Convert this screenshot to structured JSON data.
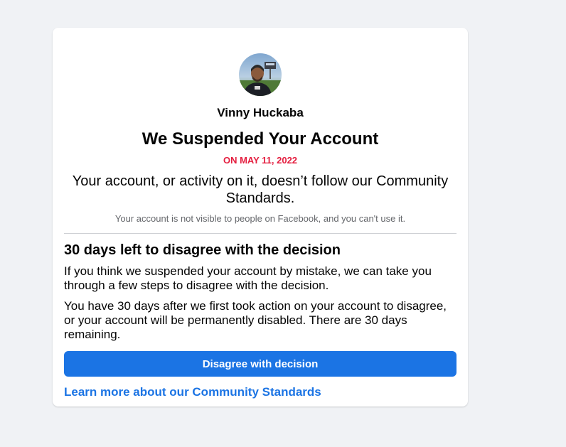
{
  "account": {
    "user_name": "Vinny Huckaba",
    "title": "We Suspended Your Account",
    "date": "ON MAY 11, 2022",
    "reason": "Your account, or activity on it, doesn’t follow our Community Standards.",
    "note": "Your account is not visible to people on Facebook, and you can't use it."
  },
  "appeal": {
    "heading": "30 days left to disagree with the decision",
    "paragraph_1": "If you think we suspended your account by mistake, we can take you through a few steps to disagree with the decision.",
    "paragraph_2": "You have 30 days after we first took action on your account to disagree, or your account will be permanently disabled. There are 30 days remaining.",
    "button_label": "Disagree with decision",
    "learn_more_link": "Learn more about our Community Standards"
  },
  "colors": {
    "page_background": "#f0f2f5",
    "accent": "#1b74e4",
    "date_red": "#e41e3f",
    "muted_text": "#65676b"
  }
}
